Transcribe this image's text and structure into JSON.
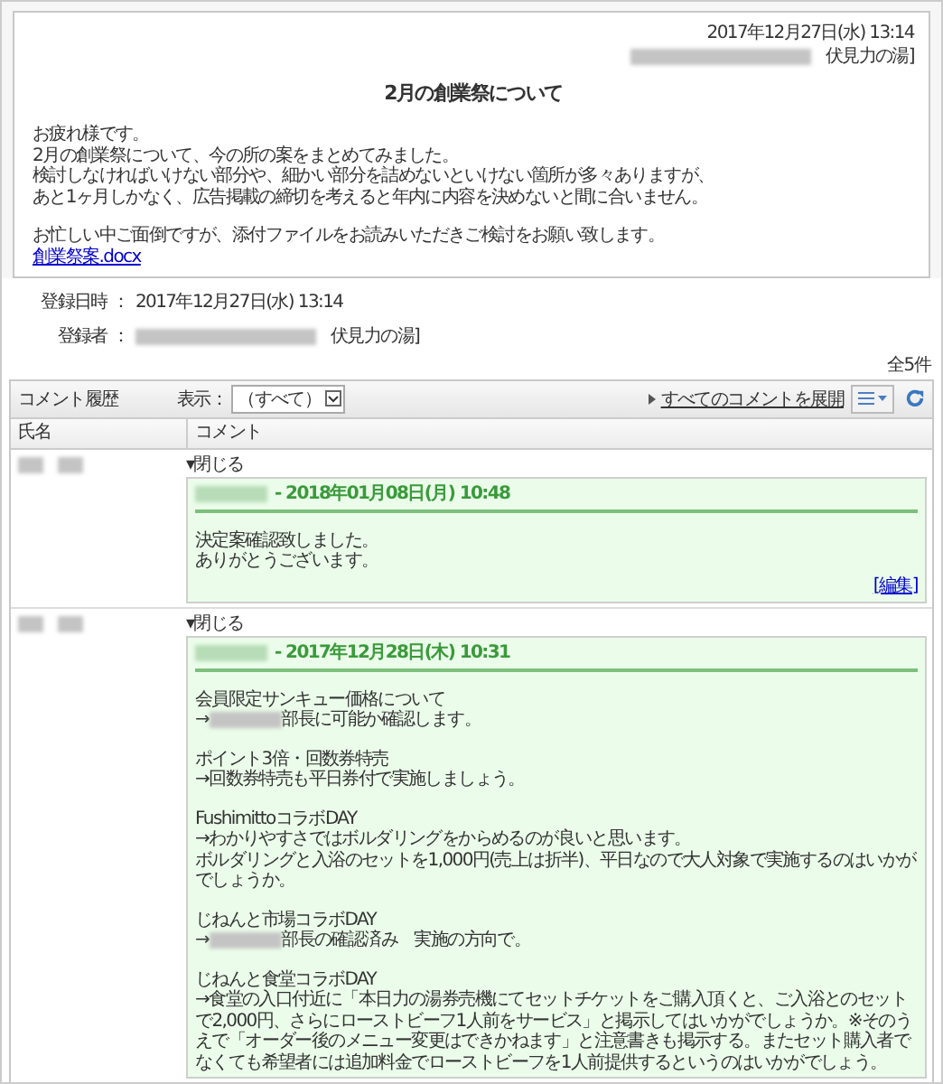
{
  "post": {
    "date": "2017年12月27日(水) 13:14",
    "author_suffix": "伏見力の湯]",
    "title": "2月の創業祭について",
    "body": [
      [
        "お疲れ様です。",
        "2月の創業祭について、今の所の案をまとめてみました。",
        "検討しなければいけない部分や、細かい部分を詰めないといけない箇所が多々ありますが、",
        "あと1ヶ月しかなく、広告掲載の締切を考えると年内に内容を決めないと間に合いません。"
      ],
      [
        "お忙しい中ご面倒ですが、添付ファイルをお読みいただきご検討をお願い致します。"
      ]
    ],
    "attachment": "創業祭案.docx"
  },
  "meta": [
    {
      "label": "登録日時 ：",
      "value": "2017年12月27日(水) 13:14",
      "redacted": false
    },
    {
      "label": "登録者 ：",
      "value": "伏見力の湯]",
      "redacted": true
    }
  ],
  "total": "全5件",
  "toolbar": {
    "title": "コメント履歴",
    "filter_label": "表示：",
    "filter_value": "（すべて）",
    "expand_all": "すべてのコメントを展開"
  },
  "columns": [
    "氏名",
    "コメント"
  ],
  "comments": [
    {
      "toggle": "▾閉じる",
      "expanded": true,
      "date": "- 2018年01月08日(月) 10:48",
      "edit": "[編集]",
      "paragraphs": [
        [
          {
            "text": "決定案確認致しました。"
          },
          {
            "text": "ありがとうございます。"
          }
        ]
      ]
    },
    {
      "toggle": "▾閉じる",
      "expanded": true,
      "date": "- 2017年12月28日(木) 10:31",
      "paragraphs": [
        [
          {
            "text": "会員限定サンキュー価格について"
          },
          {
            "kind": "redacted",
            "prefix": "→",
            "text": "部長に可能か確認します。"
          }
        ],
        [
          {
            "text": "ポイント3倍・回数券特売"
          },
          {
            "text": "→回数券特売も平日券付で実施しましょう。"
          }
        ],
        [
          {
            "text": "FushimittoコラボDAY"
          },
          {
            "text": "→わかりやすさではボルダリングをからめるのが良いと思います。"
          },
          {
            "text": "ボルダリングと入浴のセットを1,000円(売上は折半)、平日なので大人対象で実施するのはいかがでしょうか。"
          }
        ],
        [
          {
            "text": "じねんと市場コラボDAY"
          },
          {
            "kind": "redacted",
            "prefix": "→",
            "text": "部長の確認済み　実施の方向で。"
          }
        ],
        [
          {
            "text": "じねんと食堂コラボDAY"
          },
          {
            "text": "→食堂の入口付近に「本日力の湯券売機にてセットチケットをご購入頂くと、ご入浴とのセットで2,000円、さらにローストビーフ1人前をサービス」と掲示してはいかがでしょうか。※そのうえで「オーダー後のメニュー変更はできかねます」と注意書きも掲示する。またセット購入者でなくても希望者には追加料金でローストビーフを1人前提供するというのはいかがでしょう。"
          }
        ]
      ]
    }
  ]
}
